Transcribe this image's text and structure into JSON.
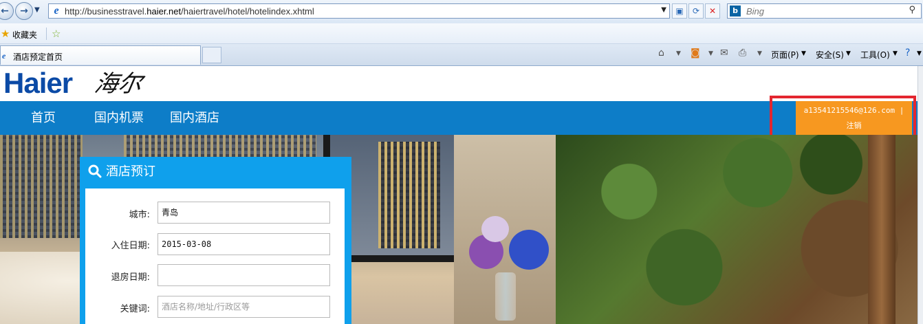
{
  "browser": {
    "url_prefix": "http://businesstravel.",
    "url_domain": "haier.net",
    "url_path": "/haiertravel/hotel/hotelindex.xhtml",
    "search_placeholder": "Bing",
    "favorites_label": "收藏夹",
    "tab_title": "酒店预定首页",
    "commands": {
      "page": "页面(P)",
      "safety": "安全(S)",
      "tools": "工具(O)"
    }
  },
  "site": {
    "logo_text": "Haier",
    "logo_cn": "海尔",
    "nav": [
      "首页",
      "国内机票",
      "国内酒店"
    ],
    "user_email": "a13541215546@126.com |",
    "logout_label": "注销"
  },
  "booking": {
    "title": "酒店预订",
    "city_label": "城市:",
    "city_value": "青岛",
    "checkin_label": "入住日期:",
    "checkin_value": "2015-03-08",
    "checkout_label": "退房日期:",
    "checkout_value": "",
    "keyword_label": "关键词:",
    "keyword_placeholder": "酒店名称/地址/行政区等"
  },
  "colors": {
    "nav_bg": "#0d7dc8",
    "user_box_bg": "#f79820",
    "highlight_border": "#e3262f",
    "booking_bg": "#0fa0ec"
  }
}
